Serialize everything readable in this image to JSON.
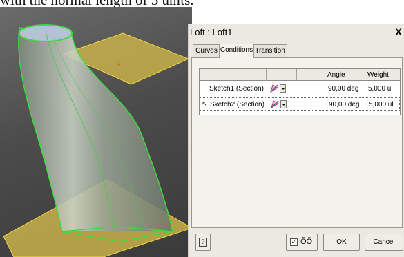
{
  "caption": {
    "text": "with the normal length of 5 units."
  },
  "dialog": {
    "title": "Loft : Loft1",
    "close_label": "X",
    "tabs": [
      {
        "label": "Curves",
        "active": false
      },
      {
        "label": "Conditions",
        "active": true
      },
      {
        "label": "Transition",
        "active": false
      }
    ],
    "table": {
      "columns": [
        "",
        "",
        "",
        "",
        "Angle",
        "Weight"
      ],
      "rows": [
        {
          "name": "Sketch1 (Section)",
          "angle": "90,00 deg",
          "weight": "5,000 ul"
        },
        {
          "name": "Sketch2 (Section)",
          "angle": "90,00 deg",
          "weight": "5,000 ul"
        }
      ]
    },
    "footer": {
      "help_label": "?",
      "preview_checked": true,
      "preview_icon": "glasses-icon",
      "ok_label": "OK",
      "cancel_label": "Cancel"
    }
  },
  "colors": {
    "viewport_bg": "#4b4b4b",
    "plane_fill": "#d9c35a",
    "loft_edge": "#3ddc3d",
    "dialog_bg": "#ece9e2"
  }
}
